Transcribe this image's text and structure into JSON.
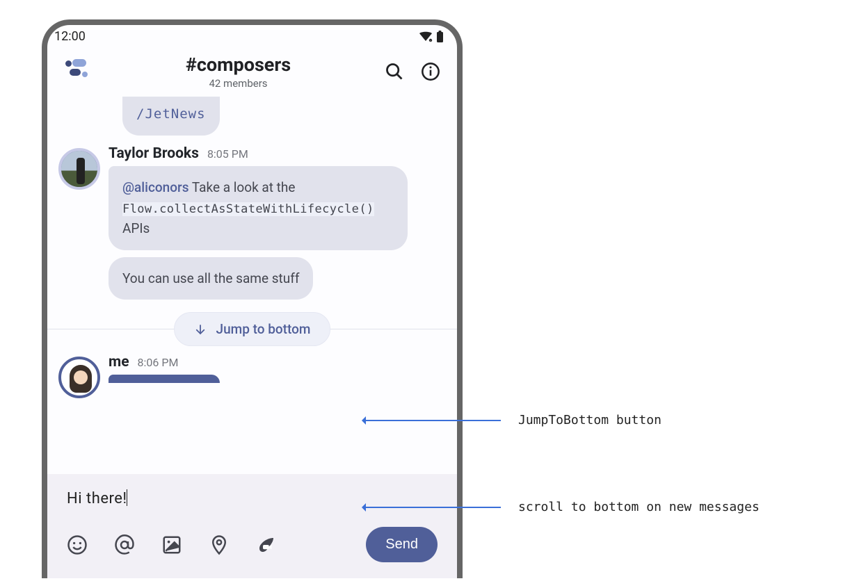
{
  "status": {
    "time": "12:00"
  },
  "header": {
    "channel": "#composers",
    "members": "42 members"
  },
  "chat": {
    "top_partial": "/JetNews",
    "taylor": {
      "name": "Taylor Brooks",
      "time": "8:05 PM",
      "msg1_mention": "@aliconors",
      "msg1_before": " Take a look at the ",
      "msg1_code": "Flow.collectAsStateWithLifecycle()",
      "msg1_after": " APIs",
      "msg2": "You can use all the same stuff"
    },
    "jump_label": "Jump to bottom",
    "me": {
      "name": "me",
      "time": "8:06 PM"
    }
  },
  "composer": {
    "text": "Hi there!",
    "send_label": "Send"
  },
  "annotations": {
    "a1": "JumpToBottom button",
    "a2": "scroll to bottom on new messages"
  }
}
